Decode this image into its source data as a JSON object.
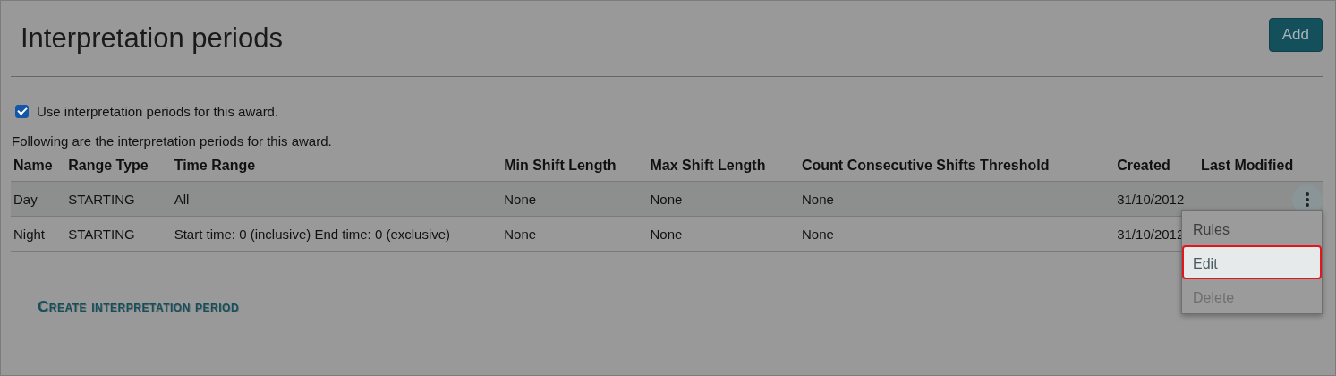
{
  "page": {
    "title": "Interpretation periods",
    "add_button": "Add"
  },
  "use_periods": {
    "label": "Use interpretation periods for this award.",
    "checked": true
  },
  "intro": "Following are the interpretation periods for this award.",
  "table": {
    "columns": [
      "Name",
      "Range Type",
      "Time Range",
      "Min Shift Length",
      "Max Shift Length",
      "Count Consecutive Shifts Threshold",
      "Created",
      "Last Modified"
    ],
    "rows": [
      {
        "cells": [
          "Day",
          "STARTING",
          "All",
          "None",
          "None",
          "None",
          "31/10/2012",
          ""
        ],
        "selected": true
      },
      {
        "cells": [
          "Night",
          "STARTING",
          "Start time: 0 (inclusive) End time: 0 (exclusive)",
          "None",
          "None",
          "None",
          "31/10/2012",
          ""
        ],
        "selected": false
      }
    ]
  },
  "row_menu": {
    "items": [
      {
        "label": "Rules",
        "selected": false,
        "disabled": false
      },
      {
        "label": "Edit",
        "selected": true,
        "disabled": false
      },
      {
        "label": "Delete",
        "selected": false,
        "disabled": true
      }
    ]
  },
  "create_link": "Create interpretation period"
}
